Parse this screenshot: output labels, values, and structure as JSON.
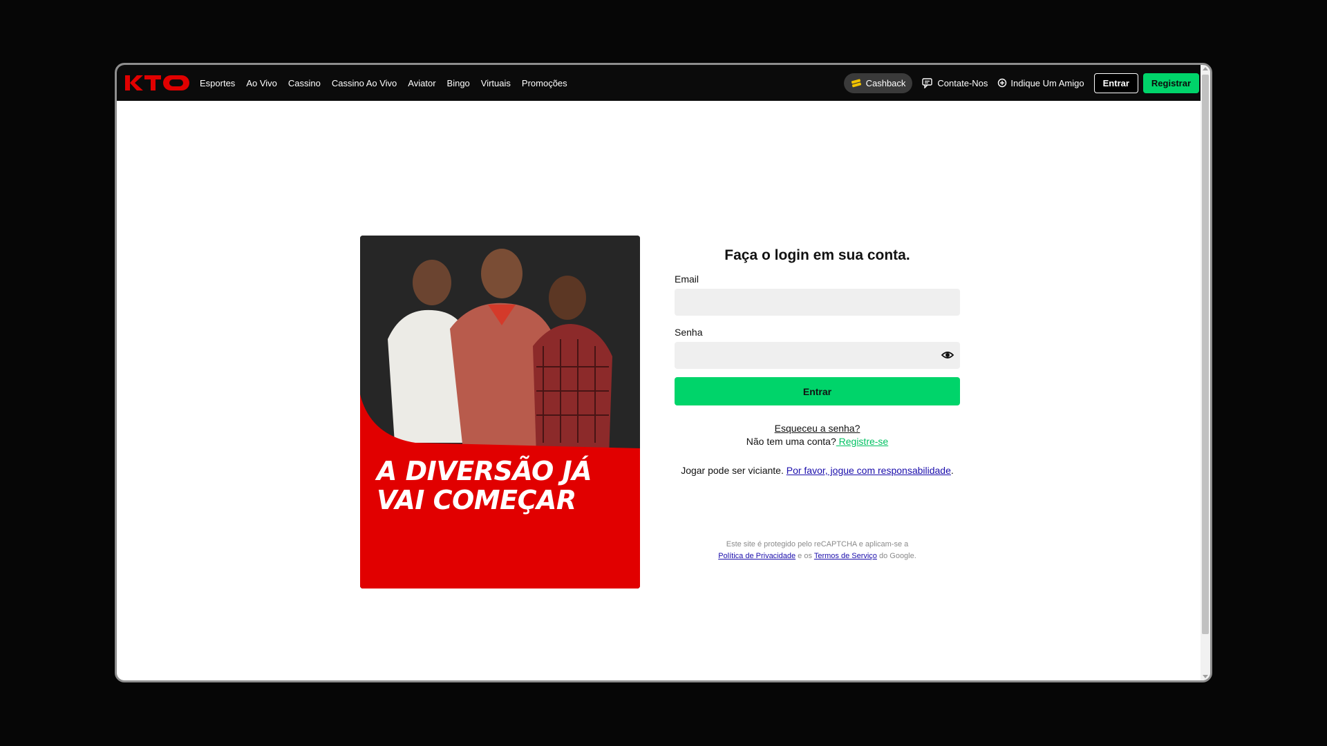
{
  "nav": {
    "brand": "KTO",
    "links": [
      "Esportes",
      "Ao Vivo",
      "Cassino",
      "Cassino Ao Vivo",
      "Aviator",
      "Bingo",
      "Virtuais",
      "Promoções"
    ],
    "cashback": "Cashback",
    "contact": "Contate-Nos",
    "refer": "Indique Um Amigo",
    "login_button": "Entrar",
    "register_button": "Registrar"
  },
  "promo": {
    "headline_line1": "A DIVERSÃO JÁ",
    "headline_line2": "VAI COMEÇAR"
  },
  "login": {
    "title": "Faça o login em sua conta.",
    "email_label": "Email",
    "email_value": "",
    "password_label": "Senha",
    "password_value": "",
    "submit": "Entrar",
    "forgot": "Esqueceu a senha?",
    "no_account": "Não tem uma conta?",
    "register_link": " Registre-se",
    "responsible_text": "Jogar pode ser viciante. ",
    "responsible_link": "Por favor, jogue com responsabilidade",
    "responsible_end": "."
  },
  "recaptcha": {
    "text1": "Este site é protegido pelo reCAPTCHA e aplicam-se a ",
    "privacy": "Política de Privacidade",
    "text2": " e os ",
    "terms": "Termos de Serviço",
    "text3": " do Google."
  },
  "colors": {
    "brand_red": "#e10000",
    "accent_green": "#00d46a",
    "nav_bg": "#0b0b0b"
  },
  "icons": [
    "coins-icon",
    "chat-icon",
    "refer-icon",
    "eye-icon"
  ]
}
